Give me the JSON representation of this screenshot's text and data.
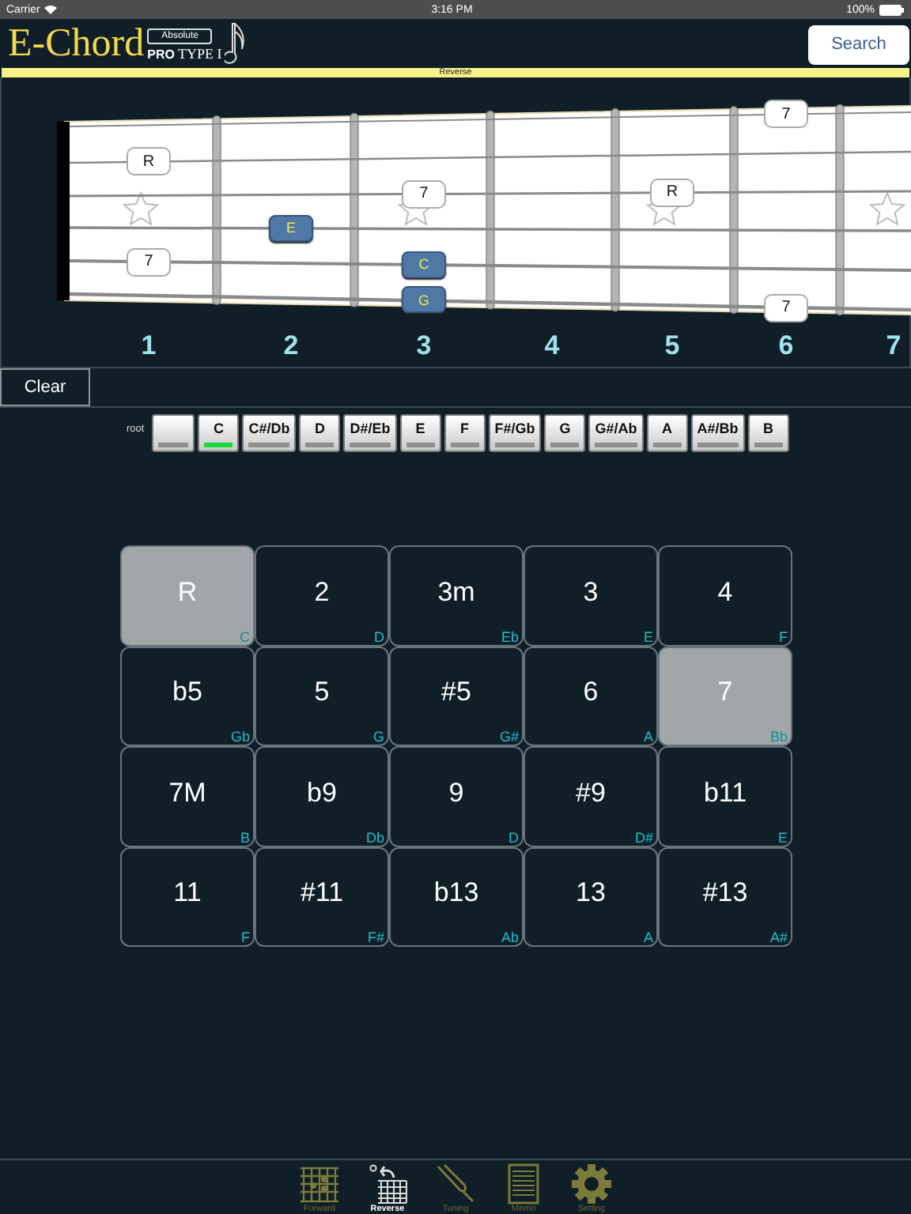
{
  "status_bar": {
    "carrier": "Carrier",
    "time": "3:16 PM",
    "battery": "100%"
  },
  "header": {
    "logo": "E-Chord",
    "badge": "Absolute",
    "edition": "PRO",
    "type": "TYPE I",
    "search_button": "Search"
  },
  "mode_bar": {
    "label": "Reverse"
  },
  "fretboard": {
    "frets": [
      {
        "number": "1",
        "strings": [
          {
            "kind": "empty"
          },
          {
            "kind": "interval",
            "label": "R"
          },
          {
            "kind": "empty"
          },
          {
            "kind": "empty"
          },
          {
            "kind": "interval",
            "label": "7"
          },
          {
            "kind": "empty"
          }
        ]
      },
      {
        "number": "2",
        "strings": [
          {
            "kind": "empty"
          },
          {
            "kind": "empty"
          },
          {
            "kind": "empty"
          },
          {
            "kind": "note",
            "label": "E"
          },
          {
            "kind": "empty"
          },
          {
            "kind": "empty"
          }
        ]
      },
      {
        "number": "3",
        "strings": [
          {
            "kind": "empty"
          },
          {
            "kind": "empty"
          },
          {
            "kind": "interval",
            "label": "7"
          },
          {
            "kind": "empty"
          },
          {
            "kind": "note",
            "label": "C"
          },
          {
            "kind": "note",
            "label": "G"
          }
        ]
      },
      {
        "number": "4",
        "strings": [
          {
            "kind": "empty"
          },
          {
            "kind": "empty"
          },
          {
            "kind": "empty"
          },
          {
            "kind": "empty"
          },
          {
            "kind": "empty"
          },
          {
            "kind": "empty"
          }
        ]
      },
      {
        "number": "5",
        "strings": [
          {
            "kind": "empty"
          },
          {
            "kind": "empty"
          },
          {
            "kind": "interval",
            "label": "R"
          },
          {
            "kind": "empty"
          },
          {
            "kind": "empty"
          },
          {
            "kind": "empty"
          }
        ]
      },
      {
        "number": "6",
        "strings": [
          {
            "kind": "interval",
            "label": "7"
          },
          {
            "kind": "empty"
          },
          {
            "kind": "empty"
          },
          {
            "kind": "empty"
          },
          {
            "kind": "empty"
          },
          {
            "kind": "interval",
            "label": "7"
          }
        ]
      },
      {
        "number": "7",
        "strings": [
          {
            "kind": "empty"
          },
          {
            "kind": "empty"
          },
          {
            "kind": "empty"
          },
          {
            "kind": "empty"
          },
          {
            "kind": "empty"
          },
          {
            "kind": "empty"
          }
        ]
      }
    ]
  },
  "clear_button": "Clear",
  "root_picker": {
    "label": "root",
    "keys": [
      {
        "kind": "blank",
        "selected": false
      },
      {
        "kind": "key",
        "label": "C",
        "selected": true
      },
      {
        "kind": "key",
        "label": "C#/Db",
        "selected": false
      },
      {
        "kind": "key",
        "label": "D",
        "selected": false
      },
      {
        "kind": "key",
        "label": "D#/Eb",
        "selected": false
      },
      {
        "kind": "key",
        "label": "E",
        "selected": false
      },
      {
        "kind": "key",
        "label": "F",
        "selected": false
      },
      {
        "kind": "key",
        "label": "F#/Gb",
        "selected": false
      },
      {
        "kind": "key",
        "label": "G",
        "selected": false
      },
      {
        "kind": "key",
        "label": "G#/Ab",
        "selected": false
      },
      {
        "kind": "key",
        "label": "A",
        "selected": false
      },
      {
        "kind": "key",
        "label": "A#/Bb",
        "selected": false
      },
      {
        "kind": "key",
        "label": "B",
        "selected": false
      }
    ]
  },
  "intervals": [
    {
      "label": "R",
      "note": "C",
      "selected": true
    },
    {
      "label": "2",
      "note": "D",
      "selected": false
    },
    {
      "label": "3m",
      "note": "Eb",
      "selected": false
    },
    {
      "label": "3",
      "note": "E",
      "selected": false
    },
    {
      "label": "4",
      "note": "F",
      "selected": false
    },
    {
      "label": "b5",
      "note": "Gb",
      "selected": false
    },
    {
      "label": "5",
      "note": "G",
      "selected": false
    },
    {
      "label": "#5",
      "note": "G#",
      "selected": false
    },
    {
      "label": "6",
      "note": "A",
      "selected": false
    },
    {
      "label": "7",
      "note": "Bb",
      "selected": true
    },
    {
      "label": "7M",
      "note": "B",
      "selected": false
    },
    {
      "label": "b9",
      "note": "Db",
      "selected": false
    },
    {
      "label": "9",
      "note": "D",
      "selected": false
    },
    {
      "label": "#9",
      "note": "D#",
      "selected": false
    },
    {
      "label": "b11",
      "note": "E",
      "selected": false
    },
    {
      "label": "11",
      "note": "F",
      "selected": false
    },
    {
      "label": "#11",
      "note": "F#",
      "selected": false
    },
    {
      "label": "b13",
      "note": "Ab",
      "selected": false
    },
    {
      "label": "13",
      "note": "A",
      "selected": false
    },
    {
      "label": "#13",
      "note": "A#",
      "selected": false
    }
  ],
  "tab_bar": [
    {
      "kind": "forward",
      "label": "Forward",
      "selected": false
    },
    {
      "kind": "reverse",
      "label": "Reverse",
      "selected": true
    },
    {
      "kind": "tuning",
      "label": "Tuning",
      "selected": false
    },
    {
      "kind": "memo",
      "label": "Memo",
      "selected": false
    },
    {
      "kind": "setting",
      "label": "Setting",
      "selected": false
    }
  ]
}
